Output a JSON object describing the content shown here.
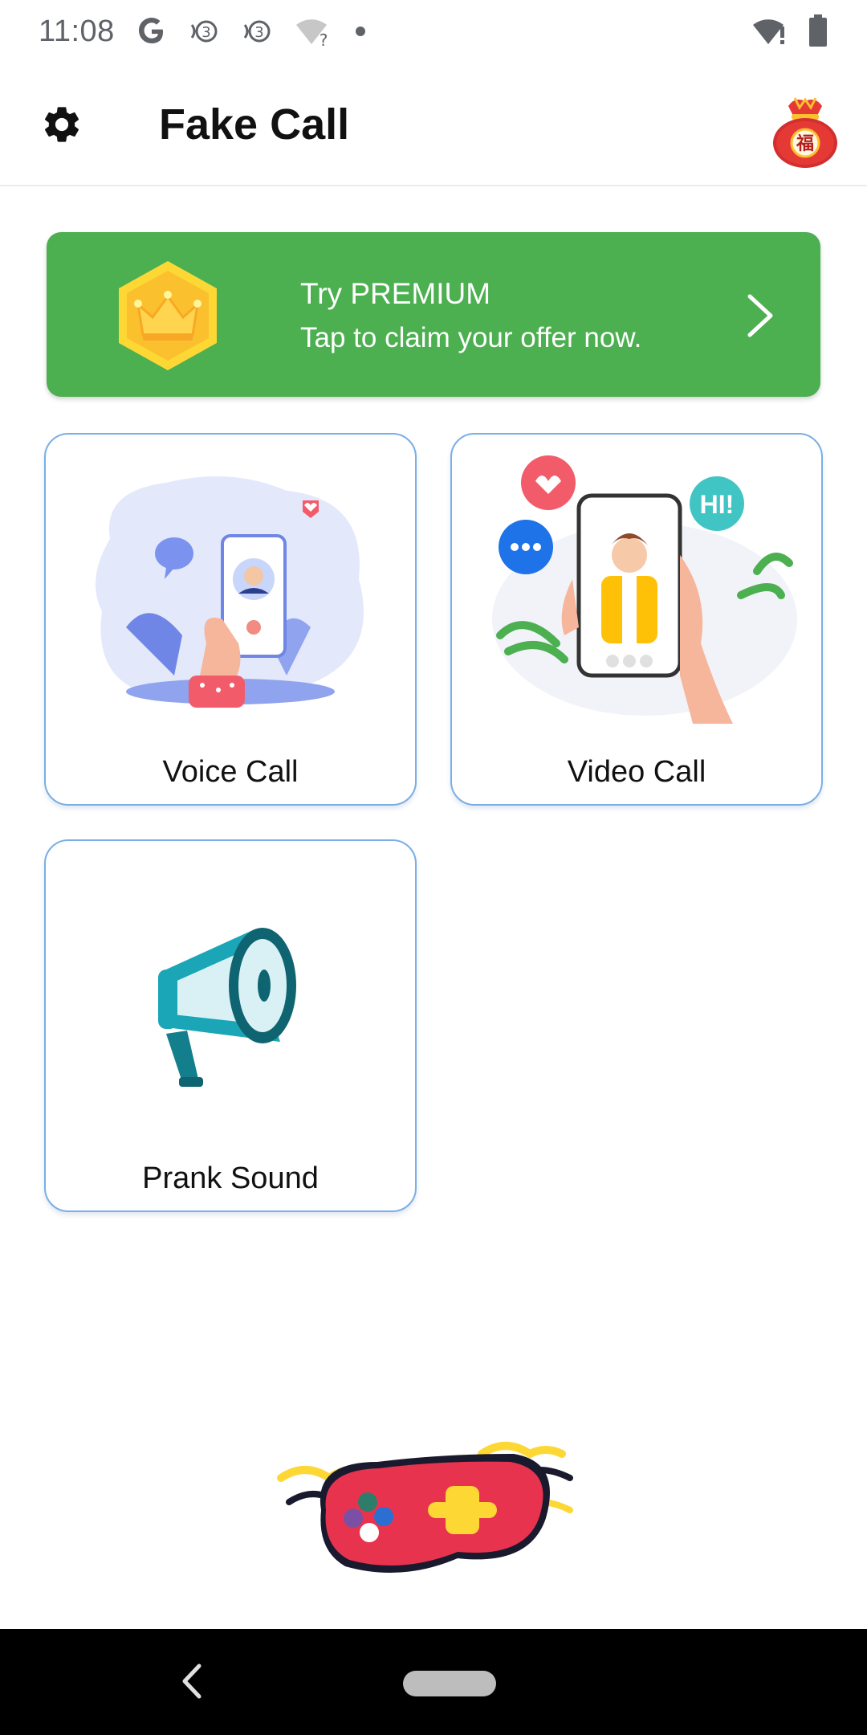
{
  "status_bar": {
    "time": "11:08",
    "icons": [
      "google-icon",
      "nfc-icon",
      "nfc-icon",
      "wifi-question-icon",
      "dot-icon",
      "wifi-alert-icon",
      "battery-icon"
    ]
  },
  "app_bar": {
    "title": "Fake Call",
    "settings_icon": "gear-icon",
    "lucky_bag_icon": "lucky-bag-icon",
    "lucky_bag_char": "福"
  },
  "premium": {
    "title": "Try PREMIUM",
    "subtitle": "Tap to claim your offer now.",
    "icon": "crown-icon",
    "background": "#4caf50"
  },
  "cards": {
    "voice": {
      "label": "Voice Call",
      "icon": "voice-call-illustration"
    },
    "video": {
      "label": "Video Call",
      "icon": "video-call-illustration",
      "bubble_text": "HI!"
    },
    "prank": {
      "label": "Prank Sound",
      "icon": "megaphone-icon"
    }
  },
  "colors": {
    "card_border": "#7aaee6",
    "accent_green": "#4caf50"
  },
  "nav_bar": {
    "back_icon": "back-chevron-icon",
    "home_icon": "home-pill-icon"
  }
}
